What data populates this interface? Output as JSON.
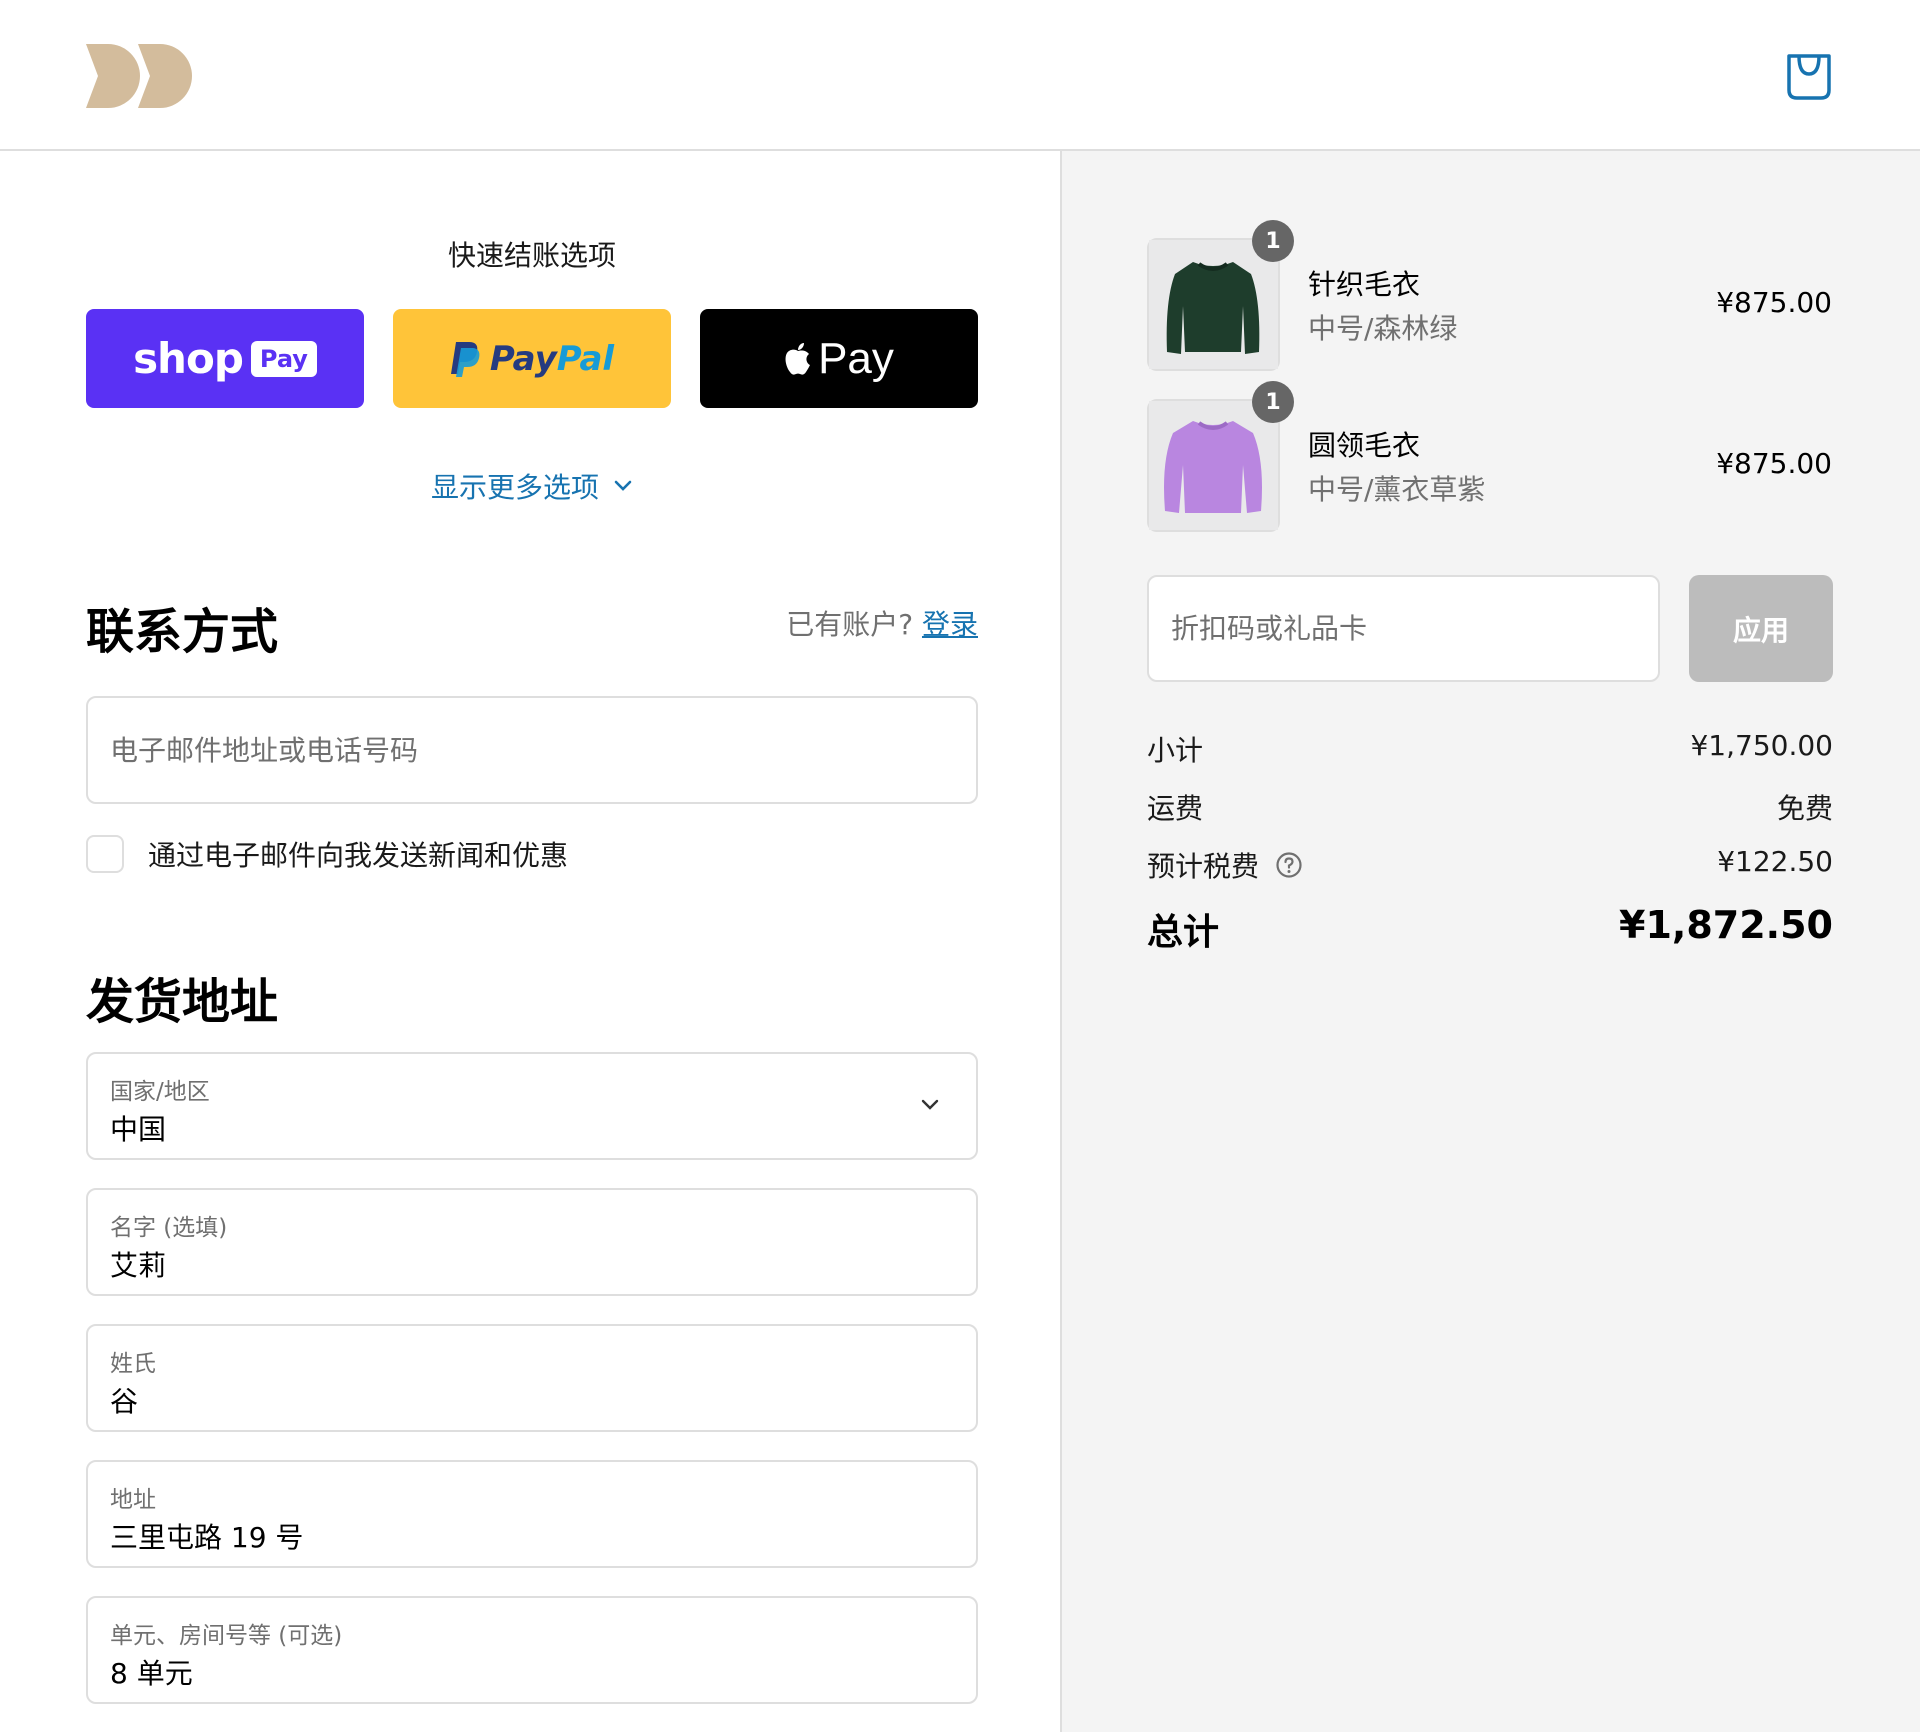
{
  "header": {
    "logo": "brand-logo",
    "cart_icon": "shopping-bag-icon",
    "accent_color": "#1773b0",
    "logo_color": "#d3bc9c"
  },
  "express_checkout": {
    "title": "快速结账选项",
    "shop_pay": {
      "text": "shop",
      "pill": "Pay",
      "color": "#5a31f4"
    },
    "paypal": {
      "text_a": "Pay",
      "text_b": "Pal",
      "color": "#ffc439"
    },
    "apple_pay": {
      "text": "Pay",
      "color": "#000000"
    },
    "more_options": "显示更多选项"
  },
  "contact": {
    "title": "联系方式",
    "have_account": "已有账户?",
    "login_link": "登录",
    "email_placeholder": "电子邮件地址或电话号码",
    "newsletter_label": "通过电子邮件向我发送新闻和优惠",
    "newsletter_checked": false
  },
  "shipping": {
    "title": "发货地址",
    "fields": [
      {
        "label": "国家/地区",
        "value": "中国"
      },
      {
        "label": "名字 (选填)",
        "value": "艾莉"
      },
      {
        "label": "姓氏",
        "value": "谷"
      },
      {
        "label": "地址",
        "value": "三里屯路 19 号"
      },
      {
        "label": "单元、房间号等 (可选)",
        "value": "8 单元"
      }
    ]
  },
  "summary": {
    "items": [
      {
        "qty": "1",
        "name": "针织毛衣",
        "variant": "中号/森林绿",
        "price": "¥875.00",
        "image": "green-sweater",
        "color": "#1e3d2c"
      },
      {
        "qty": "1",
        "name": "圆领毛衣",
        "variant": "中号/薰衣草紫",
        "price": "¥875.00",
        "image": "lavender-sweater",
        "color": "#b986e0"
      }
    ],
    "discount_placeholder": "折扣码或礼品卡",
    "apply_label": "应用",
    "subtotal_label": "小计",
    "subtotal_value": "¥1,750.00",
    "shipping_label": "运费",
    "shipping_value": "免费",
    "tax_label": "预计税费",
    "tax_value": "¥122.50",
    "total_label": "总计",
    "total_value": "¥1,872.50"
  }
}
